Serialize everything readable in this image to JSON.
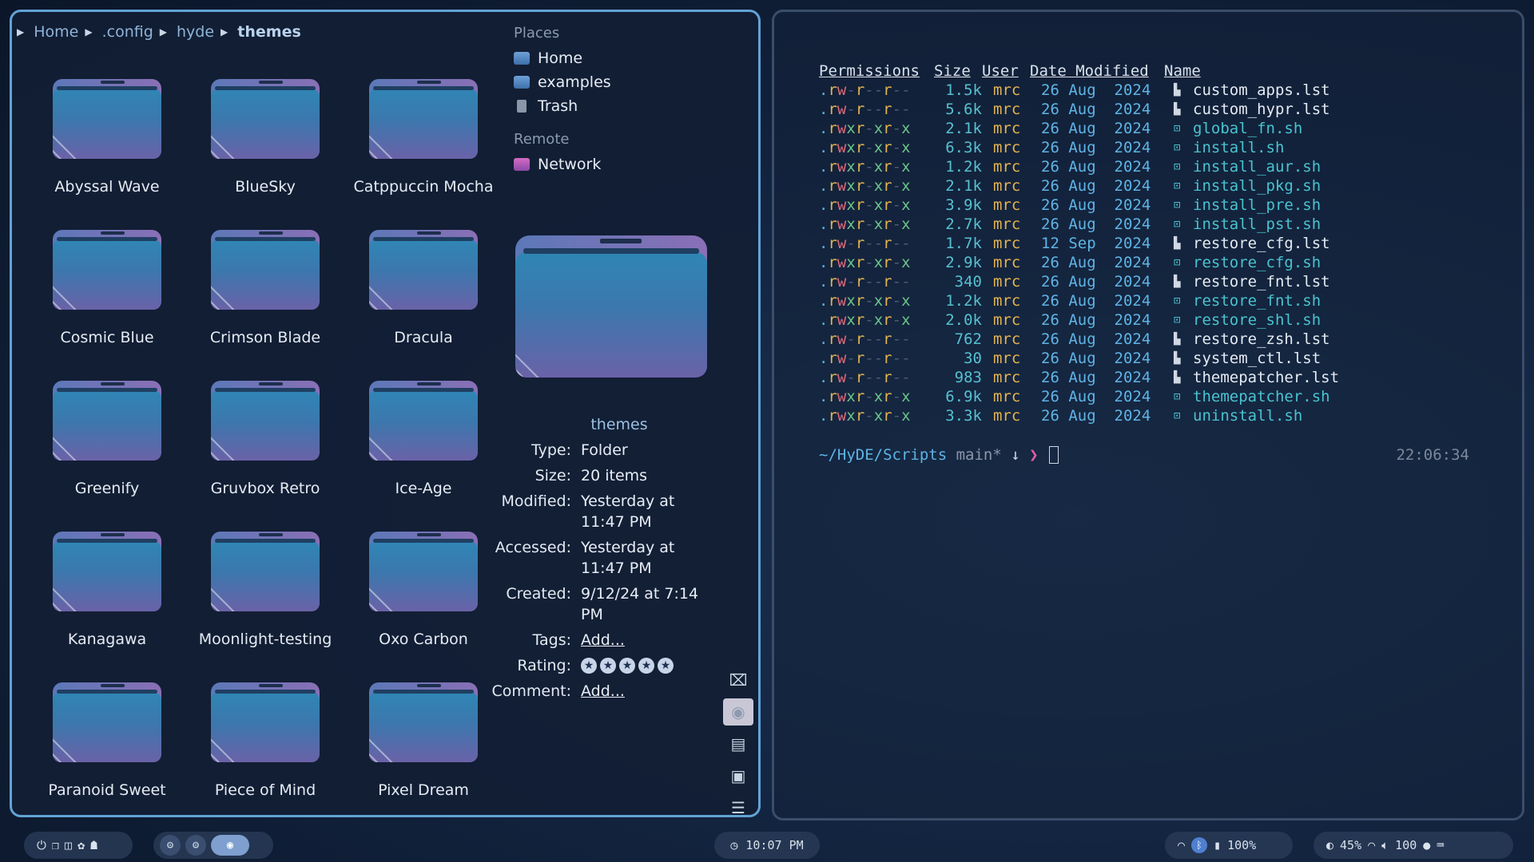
{
  "file_manager": {
    "breadcrumbs": [
      "Home",
      ".config",
      "hyde",
      "themes"
    ],
    "folders": [
      "Abyssal Wave",
      "BlueSky",
      "Catppuccin Mocha",
      "Cosmic Blue",
      "Crimson Blade",
      "Dracula",
      "Greenify",
      "Gruvbox Retro",
      "Ice-Age",
      "Kanagawa",
      "Moonlight-testing",
      "Oxo Carbon",
      "Paranoid Sweet",
      "Piece of Mind",
      "Pixel Dream"
    ],
    "places_heading": "Places",
    "places": [
      "Home",
      "examples",
      "Trash"
    ],
    "remote_heading": "Remote",
    "remote": [
      "Network"
    ],
    "info": {
      "title": "themes",
      "type_label": "Type:",
      "type_value": "Folder",
      "size_label": "Size:",
      "size_value": "20 items",
      "modified_label": "Modified:",
      "modified_value": "Yesterday at 11:47 PM",
      "accessed_label": "Accessed:",
      "accessed_value": "Yesterday at 11:47 PM",
      "created_label": "Created:",
      "created_value": "9/12/24 at 7:14 PM",
      "tags_label": "Tags:",
      "tags_value": "Add...",
      "rating_label": "Rating:",
      "rating_stars": 0,
      "comment_label": "Comment:",
      "comment_value": "Add..."
    }
  },
  "terminal": {
    "headers": [
      "Permissions",
      "Size",
      "User",
      "Date Modified",
      "Name"
    ],
    "rows": [
      {
        "perm": ".rw-r--r--",
        "size": "1.5k",
        "user": "mrc",
        "date": "26 Aug  2024",
        "name": "custom_apps.lst",
        "exec": false
      },
      {
        "perm": ".rw-r--r--",
        "size": "5.6k",
        "user": "mrc",
        "date": "26 Aug  2024",
        "name": "custom_hypr.lst",
        "exec": false
      },
      {
        "perm": ".rwxr-xr-x",
        "size": "2.1k",
        "user": "mrc",
        "date": "26 Aug  2024",
        "name": "global_fn.sh",
        "exec": true
      },
      {
        "perm": ".rwxr-xr-x",
        "size": "6.3k",
        "user": "mrc",
        "date": "26 Aug  2024",
        "name": "install.sh",
        "exec": true
      },
      {
        "perm": ".rwxr-xr-x",
        "size": "1.2k",
        "user": "mrc",
        "date": "26 Aug  2024",
        "name": "install_aur.sh",
        "exec": true
      },
      {
        "perm": ".rwxr-xr-x",
        "size": "2.1k",
        "user": "mrc",
        "date": "26 Aug  2024",
        "name": "install_pkg.sh",
        "exec": true
      },
      {
        "perm": ".rwxr-xr-x",
        "size": "3.9k",
        "user": "mrc",
        "date": "26 Aug  2024",
        "name": "install_pre.sh",
        "exec": true
      },
      {
        "perm": ".rwxr-xr-x",
        "size": "2.7k",
        "user": "mrc",
        "date": "26 Aug  2024",
        "name": "install_pst.sh",
        "exec": true
      },
      {
        "perm": ".rw-r--r--",
        "size": "1.7k",
        "user": "mrc",
        "date": "12 Sep  2024",
        "name": "restore_cfg.lst",
        "exec": false
      },
      {
        "perm": ".rwxr-xr-x",
        "size": "2.9k",
        "user": "mrc",
        "date": "26 Aug  2024",
        "name": "restore_cfg.sh",
        "exec": true
      },
      {
        "perm": ".rw-r--r--",
        "size": "340",
        "user": "mrc",
        "date": "26 Aug  2024",
        "name": "restore_fnt.lst",
        "exec": false
      },
      {
        "perm": ".rwxr-xr-x",
        "size": "1.2k",
        "user": "mrc",
        "date": "26 Aug  2024",
        "name": "restore_fnt.sh",
        "exec": true
      },
      {
        "perm": ".rwxr-xr-x",
        "size": "2.0k",
        "user": "mrc",
        "date": "26 Aug  2024",
        "name": "restore_shl.sh",
        "exec": true
      },
      {
        "perm": ".rw-r--r--",
        "size": "762",
        "user": "mrc",
        "date": "26 Aug  2024",
        "name": "restore_zsh.lst",
        "exec": false
      },
      {
        "perm": ".rw-r--r--",
        "size": "30",
        "user": "mrc",
        "date": "26 Aug  2024",
        "name": "system_ctl.lst",
        "exec": false
      },
      {
        "perm": ".rw-r--r--",
        "size": "983",
        "user": "mrc",
        "date": "26 Aug  2024",
        "name": "themepatcher.lst",
        "exec": false
      },
      {
        "perm": ".rwxr-xr-x",
        "size": "6.9k",
        "user": "mrc",
        "date": "26 Aug  2024",
        "name": "themepatcher.sh",
        "exec": true
      },
      {
        "perm": ".rwxr-xr-x",
        "size": "3.3k",
        "user": "mrc",
        "date": "26 Aug  2024",
        "name": "uninstall.sh",
        "exec": true
      }
    ],
    "prompt_path": "~/HyDE/Scripts",
    "prompt_branch": "main*",
    "prompt_arrow": "↓",
    "prompt_chevron": "❯",
    "right_time": "22:06:34"
  },
  "taskbar": {
    "clock": "10:07 PM",
    "battery_left": "100%",
    "brightness": "45%",
    "volume": "100"
  },
  "colors": {
    "accent_border": "#62a3d6",
    "exec_file": "#49c3cf",
    "user": "#e3b34f",
    "date": "#5fb4e5"
  }
}
